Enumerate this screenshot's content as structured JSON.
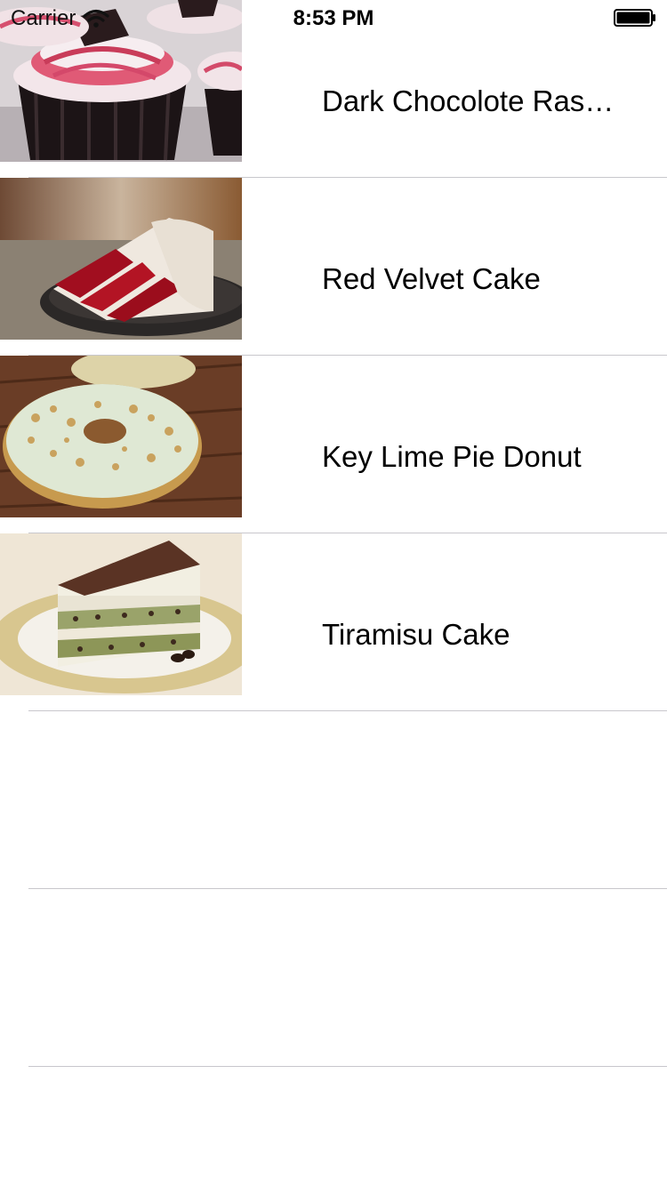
{
  "status_bar": {
    "carrier": "Carrier",
    "time": "8:53 PM",
    "icons": [
      "wifi-icon",
      "battery-icon"
    ]
  },
  "items": [
    {
      "title": "Dark Chocolote Ras…",
      "image": "cupcake-photo"
    },
    {
      "title": "Red Velvet Cake",
      "image": "red-velvet-photo"
    },
    {
      "title": "Key Lime Pie Donut",
      "image": "donut-photo"
    },
    {
      "title": "Tiramisu Cake",
      "image": "tiramisu-photo"
    }
  ],
  "colors": {
    "separator": "#c8c7cc",
    "background": "#ffffff",
    "text": "#000000"
  }
}
